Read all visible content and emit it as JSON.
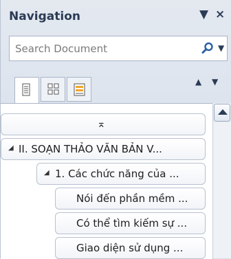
{
  "header": {
    "title": "Navigation",
    "menu_glyph": "▼",
    "close_glyph": "×"
  },
  "search": {
    "placeholder": "Search Document",
    "dropdown_glyph": "▼"
  },
  "tabs": [
    {
      "name": "headings",
      "active": true
    },
    {
      "name": "pages",
      "active": false
    },
    {
      "name": "results",
      "active": false
    }
  ],
  "nav_arrows": {
    "prev": "▲",
    "next": "▼"
  },
  "tree": {
    "collapse_glyph": "⌅",
    "items": [
      {
        "label": "II. SOẠN THẢO VĂN BẢN V...",
        "expander": "◢"
      },
      {
        "label": "1. Các chức năng của ...",
        "expander": "◢"
      },
      {
        "label": "Nói đến phần mềm ..."
      },
      {
        "label": "Có thể tìm kiếm sự ..."
      },
      {
        "label": "Giao diện sử dụng ..."
      }
    ]
  },
  "colors": {
    "title": "#2b3b55",
    "accent": "#2a5fa5"
  }
}
